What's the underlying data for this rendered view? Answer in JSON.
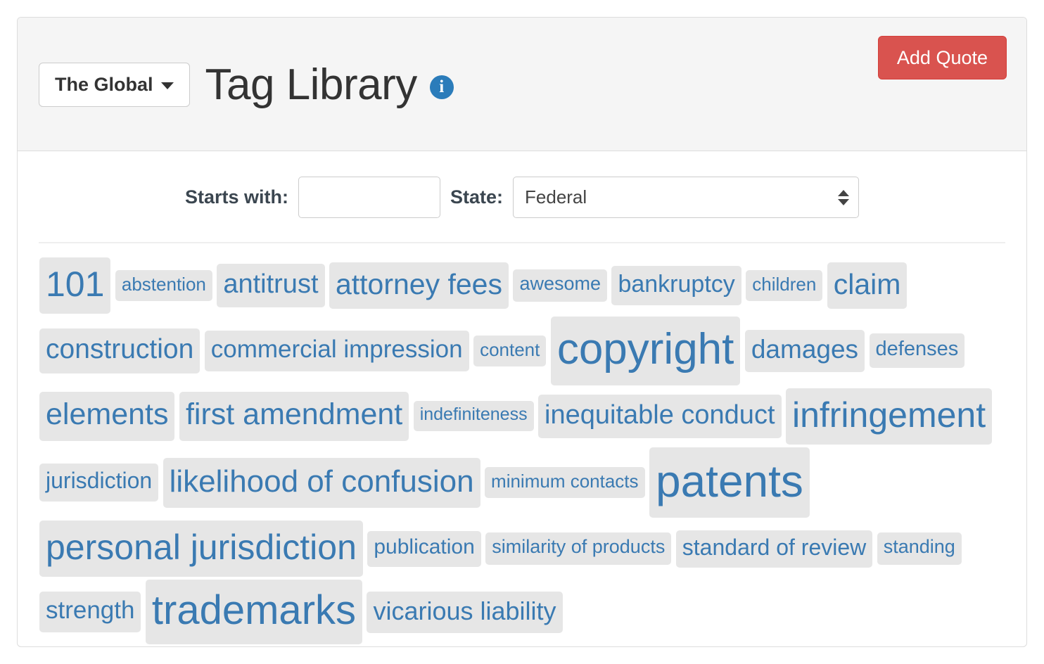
{
  "header": {
    "scope_dropdown_label": "The Global",
    "scope_dropdown_icon": "chevron-down-icon",
    "title": "Tag Library",
    "info_icon": "info-icon",
    "info_icon_glyph": "i",
    "add_quote_label": "Add Quote",
    "accent_red": "#d9534f",
    "accent_blue": "#2b7cba"
  },
  "filters": {
    "starts_with_label": "Starts with:",
    "starts_with_value": "",
    "starts_with_placeholder": "",
    "state_label": "State:",
    "state_value": "Federal"
  },
  "tag_cloud": {
    "tag_color": "#3a7ab2",
    "tag_background": "#e6e6e6",
    "tags": [
      {
        "label": "101",
        "size": 50
      },
      {
        "label": "abstention",
        "size": 26
      },
      {
        "label": "antitrust",
        "size": 38
      },
      {
        "label": "attorney fees",
        "size": 41
      },
      {
        "label": "awesome",
        "size": 27
      },
      {
        "label": "bankruptcy",
        "size": 34
      },
      {
        "label": "children",
        "size": 26
      },
      {
        "label": "claim",
        "size": 41
      },
      {
        "label": "construction",
        "size": 39
      },
      {
        "label": "commercial impression",
        "size": 35
      },
      {
        "label": "content",
        "size": 26
      },
      {
        "label": "copyright",
        "size": 62
      },
      {
        "label": "damages",
        "size": 37
      },
      {
        "label": "defenses",
        "size": 29
      },
      {
        "label": "elements",
        "size": 43
      },
      {
        "label": "first amendment",
        "size": 43
      },
      {
        "label": "indefiniteness",
        "size": 25
      },
      {
        "label": "inequitable conduct",
        "size": 38
      },
      {
        "label": "infringement",
        "size": 50
      },
      {
        "label": "jurisdiction",
        "size": 32
      },
      {
        "label": "likelihood of confusion",
        "size": 44
      },
      {
        "label": "minimum contacts",
        "size": 26
      },
      {
        "label": "patents",
        "size": 64
      },
      {
        "label": "personal jurisdiction",
        "size": 50
      },
      {
        "label": "publication",
        "size": 30
      },
      {
        "label": "similarity of products",
        "size": 27
      },
      {
        "label": "standard of review",
        "size": 32
      },
      {
        "label": "standing",
        "size": 27
      },
      {
        "label": "strength",
        "size": 35
      },
      {
        "label": "trademarks",
        "size": 58
      },
      {
        "label": "vicarious liability",
        "size": 36
      }
    ]
  }
}
